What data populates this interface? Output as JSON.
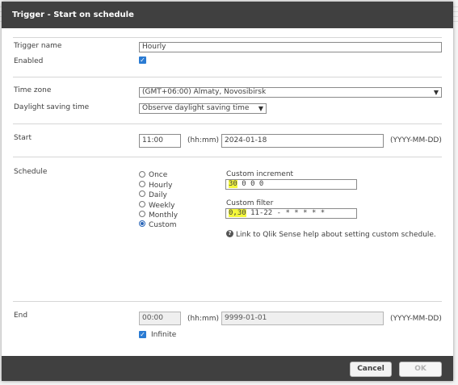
{
  "dialog": {
    "title": "Trigger - Start on schedule"
  },
  "general": {
    "trigger_name_label": "Trigger name",
    "trigger_name_value": "Hourly",
    "enabled_label": "Enabled",
    "enabled_checked": true
  },
  "timezone": {
    "time_zone_label": "Time zone",
    "time_zone_value": "(GMT+06:00) Almaty, Novosibirsk",
    "dst_label": "Daylight saving time",
    "dst_value": "Observe daylight saving time"
  },
  "start": {
    "label": "Start",
    "time_value": "11:00",
    "time_hint": "(hh:mm)",
    "date_value": "2024-01-18",
    "date_hint": "(YYYY-MM-DD)"
  },
  "schedule": {
    "label": "Schedule",
    "options": [
      "Once",
      "Hourly",
      "Daily",
      "Weekly",
      "Monthly",
      "Custom"
    ],
    "selected": "Custom",
    "custom_increment_label": "Custom increment",
    "custom_increment_highlight": "30",
    "custom_increment_rest": " 0 0 0",
    "custom_filter_label": "Custom filter",
    "custom_filter_highlight": "0,30",
    "custom_filter_rest": " 11-22 - * * * * *",
    "help_link": "Link to Qlik Sense help about setting custom schedule."
  },
  "end": {
    "label": "End",
    "time_value": "00:00",
    "time_hint": "(hh:mm)",
    "date_value": "9999-01-01",
    "date_hint": "(YYYY-MM-DD)",
    "infinite_label": "Infinite",
    "infinite_checked": true
  },
  "footer": {
    "cancel_label": "Cancel",
    "ok_label": "OK"
  },
  "colors": {
    "titlebar": "#404040",
    "checkbox": "#2a7bd3",
    "highlight": "#f4f83a"
  }
}
